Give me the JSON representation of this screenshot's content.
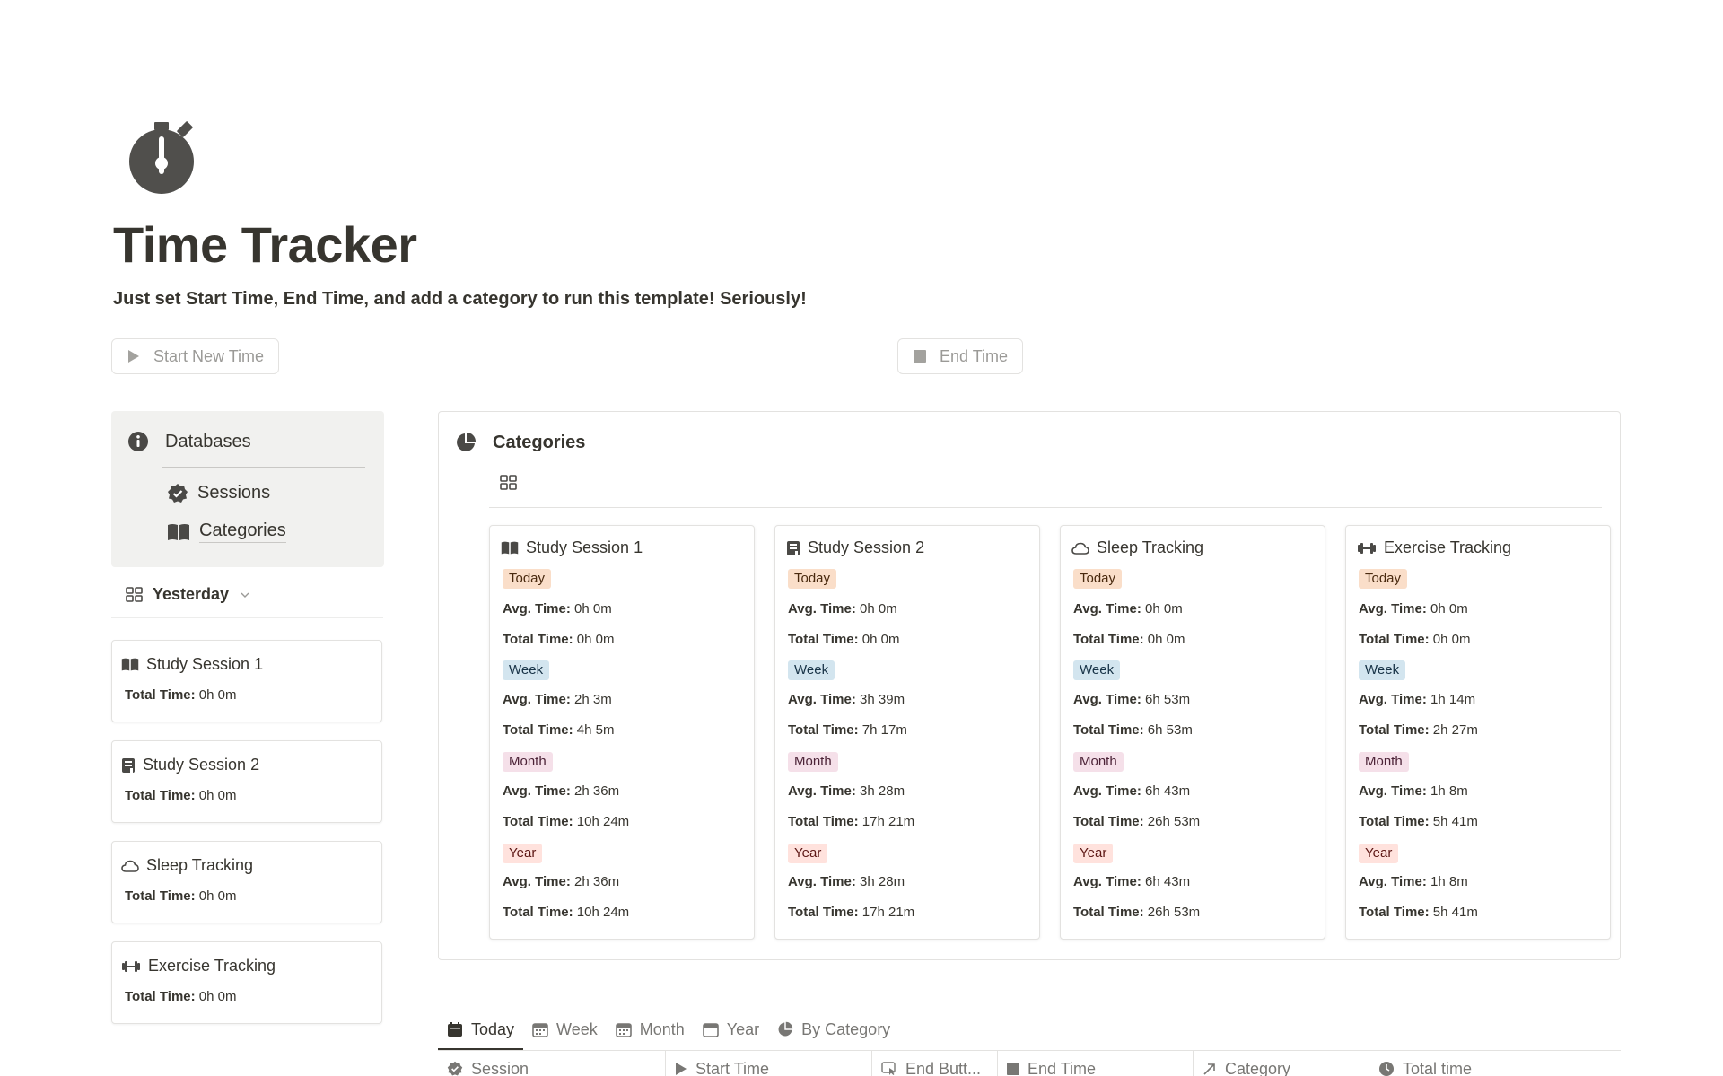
{
  "page": {
    "title": "Time Tracker",
    "subtitle": "Just set Start Time, End Time, and add a category to run this template! Seriously!",
    "icon": "stopwatch-icon"
  },
  "buttons": {
    "start": "Start New Time",
    "end": "End Time"
  },
  "databases": {
    "heading": "Databases",
    "links": [
      "Sessions",
      "Categories"
    ]
  },
  "left_view": {
    "label": "Yesterday",
    "cards": [
      {
        "name": "Study Session 1",
        "total_label": "Total Time:",
        "total": "0h 0m",
        "icon": "open-book-icon"
      },
      {
        "name": "Study Session 2",
        "total_label": "Total Time:",
        "total": "0h 0m",
        "icon": "notebook-icon"
      },
      {
        "name": "Sleep Tracking",
        "total_label": "Total Time:",
        "total": "0h 0m",
        "icon": "cloud-icon"
      },
      {
        "name": "Exercise Tracking",
        "total_label": "Total Time:",
        "total": "0h 0m",
        "icon": "dumbbell-icon"
      }
    ]
  },
  "categories": {
    "heading": "Categories",
    "labels": {
      "today": "Today",
      "week": "Week",
      "month": "Month",
      "year": "Year",
      "avg": "Avg. Time:",
      "total": "Total Time:"
    },
    "cards": [
      {
        "name": "Study Session 1",
        "icon": "open-book-icon",
        "today": {
          "avg": "0h 0m",
          "total": "0h 0m"
        },
        "week": {
          "avg": "2h 3m",
          "total": "4h 5m"
        },
        "month": {
          "avg": "2h 36m",
          "total": "10h 24m"
        },
        "year": {
          "avg": "2h 36m",
          "total": "10h 24m"
        }
      },
      {
        "name": "Study Session 2",
        "icon": "notebook-icon",
        "today": {
          "avg": "0h 0m",
          "total": "0h 0m"
        },
        "week": {
          "avg": "3h 39m",
          "total": "7h 17m"
        },
        "month": {
          "avg": "3h 28m",
          "total": "17h 21m"
        },
        "year": {
          "avg": "3h 28m",
          "total": "17h 21m"
        }
      },
      {
        "name": "Sleep Tracking",
        "icon": "cloud-icon",
        "today": {
          "avg": "0h 0m",
          "total": "0h 0m"
        },
        "week": {
          "avg": "6h 53m",
          "total": "6h 53m"
        },
        "month": {
          "avg": "6h 43m",
          "total": "26h 53m"
        },
        "year": {
          "avg": "6h 43m",
          "total": "26h 53m"
        }
      },
      {
        "name": "Exercise Tracking",
        "icon": "dumbbell-icon",
        "today": {
          "avg": "0h 0m",
          "total": "0h 0m"
        },
        "week": {
          "avg": "1h 14m",
          "total": "2h 27m"
        },
        "month": {
          "avg": "1h 8m",
          "total": "5h 41m"
        },
        "year": {
          "avg": "1h 8m",
          "total": "5h 41m"
        }
      }
    ]
  },
  "tabs": [
    "Today",
    "Week",
    "Month",
    "Year",
    "By Category"
  ],
  "table_headers": [
    "Session",
    "Start Time",
    "End Butt...",
    "End Time",
    "Category",
    "Total time"
  ],
  "colors": {
    "text": "#37352f",
    "muted": "#787774",
    "today_tag": "#fadec9",
    "week_tag": "#d3e5ef",
    "month_tag": "#f5e0e9",
    "year_tag": "#ffe2dd"
  }
}
